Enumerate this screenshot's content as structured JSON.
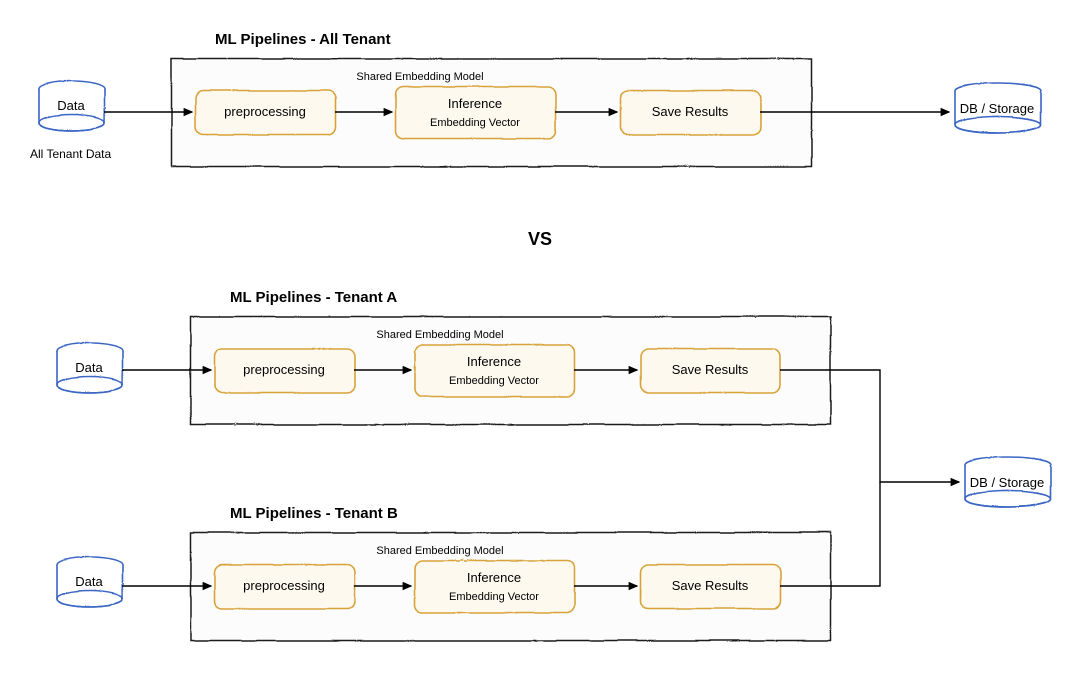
{
  "colors": {
    "blue": "#3b66c4",
    "gold": "#d8a23a",
    "goldFill": "#fdf9ef",
    "box": "#1a1a1a",
    "boxFill": "#fcfcfc"
  },
  "vs": "VS",
  "pipelines": {
    "all": {
      "title": "ML Pipelines - All Tenant",
      "cylLeft": "Data",
      "cylLeftSub": "All Tenant Data",
      "step1": "preprocessing",
      "step2top": "Shared Embedding Model",
      "step2a": "Inference",
      "step2b": "Embedding Vector",
      "step3": "Save Results",
      "cylRight": "DB / Storage"
    },
    "tenantA": {
      "title": "ML Pipelines - Tenant A",
      "cylLeft": "Data",
      "step1": "preprocessing",
      "step2top": "Shared Embedding Model",
      "step2a": "Inference",
      "step2b": "Embedding Vector",
      "step3": "Save Results"
    },
    "tenantB": {
      "title": "ML Pipelines - Tenant B",
      "cylLeft": "Data",
      "step1": "preprocessing",
      "step2top": "Shared Embedding Model",
      "step2a": "Inference",
      "step2b": "Embedding Vector",
      "step3": "Save Results"
    },
    "sharedDB": "DB / Storage"
  }
}
